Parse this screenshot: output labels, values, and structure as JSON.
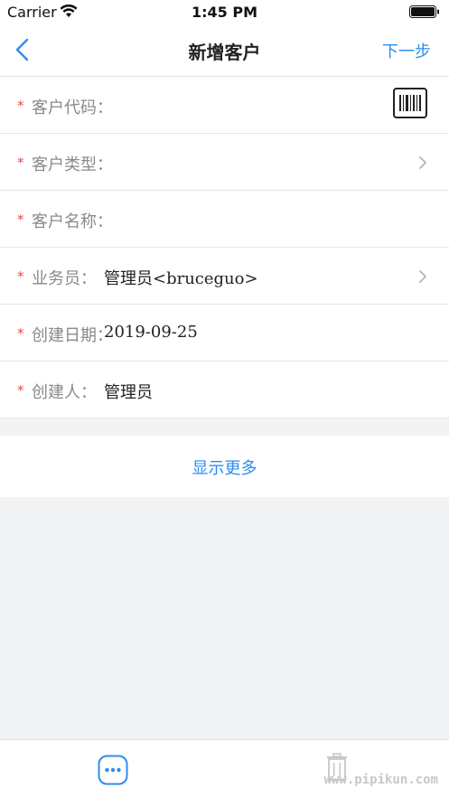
{
  "status_bar": {
    "carrier": "Carrier",
    "time": "1:45 PM",
    "wifi_icon": "wifi-icon",
    "battery_icon": "battery-icon"
  },
  "nav": {
    "back_icon": "chevron-left-icon",
    "title": "新增客户",
    "next_label": "下一步"
  },
  "form": {
    "required_mark": "*",
    "rows": [
      {
        "label": "客户代码：",
        "value": "",
        "accessory": "barcode-icon"
      },
      {
        "label": "客户类型：",
        "value": "",
        "accessory": "chevron-right-icon"
      },
      {
        "label": "客户名称：",
        "value": "",
        "accessory": ""
      },
      {
        "label": "业务员：",
        "value": "管理员<bruceguo>",
        "accessory": "chevron-right-icon"
      },
      {
        "label": "创建日期：",
        "value": "2019-09-25",
        "accessory": ""
      },
      {
        "label": "创建人：",
        "value": "管理员",
        "accessory": ""
      }
    ]
  },
  "show_more": "显示更多",
  "bottom_bar": {
    "more_icon": "more-dots-icon",
    "trash_icon": "trash-icon",
    "watermark": "www.pipikun.com"
  },
  "colors": {
    "accent": "#2d8cf0",
    "required": "#e14b4b",
    "label": "#8a8a8a",
    "background": "#f2f3f5"
  }
}
